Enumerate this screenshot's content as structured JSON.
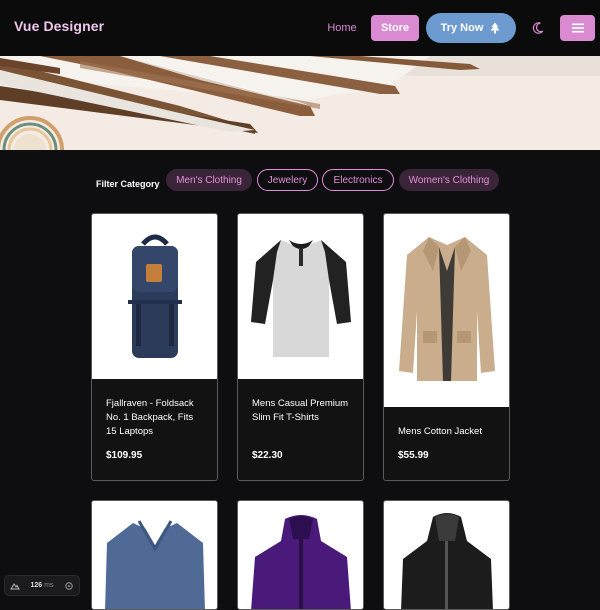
{
  "nav": {
    "brand": "Vue Designer",
    "home": "Home",
    "store": "Store",
    "try_now": "Try Now",
    "icons": [
      "tree-icon",
      "moon-icon",
      "menu-icon"
    ]
  },
  "filter": {
    "label": "Filter Category",
    "chips": [
      "Men's Clothing",
      "Jewelery",
      "Electronics",
      "Women's Clothing"
    ]
  },
  "products": [
    {
      "title": "Fjallraven - Foldsack No. 1 Backpack, Fits 15 Laptops",
      "price": "$109.95"
    },
    {
      "title": "Mens Casual Premium Slim Fit T-Shirts",
      "price": "$22.30"
    },
    {
      "title": "Mens Cotton Jacket",
      "price": "$55.99"
    },
    {
      "title": "",
      "price": ""
    },
    {
      "title": "",
      "price": ""
    },
    {
      "title": "",
      "price": ""
    }
  ],
  "mini_toolbar": {
    "value": "126",
    "unit": "ms"
  },
  "colors": {
    "accent_pink": "#d98ad1",
    "accent_blue": "#6d9bd0",
    "background": "#0e0d0f"
  }
}
